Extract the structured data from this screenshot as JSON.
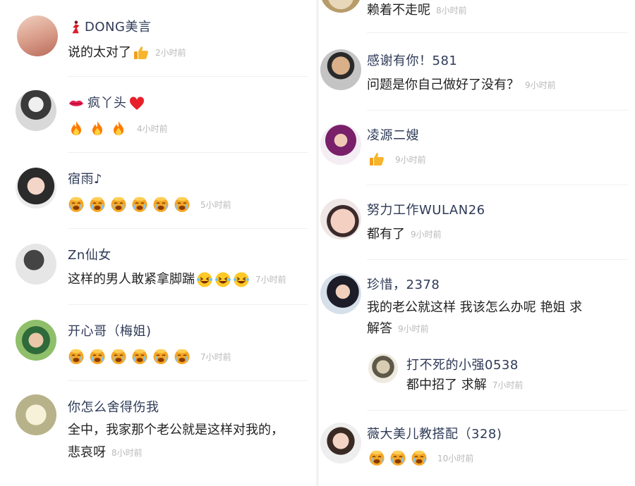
{
  "left": [
    {
      "name": "DONG美言",
      "text": "说的太对了",
      "time": "2小时前"
    },
    {
      "name": "疯丫头",
      "text": "",
      "time": "4小时前"
    },
    {
      "name": "宿雨♪",
      "text": "",
      "time": "5小时前"
    },
    {
      "name": "Zn仙女",
      "text": "这样的男人敢紧拿脚踹",
      "time": "7小时前"
    },
    {
      "name": "开心哥（梅姐)",
      "text": "",
      "time": "7小时前"
    },
    {
      "name": "你怎么舍得伤我",
      "text1": "全中，我家那个老公就是这样对我的，",
      "text2": "悲哀呀",
      "time": "8小时前"
    }
  ],
  "right": [
    {
      "name": "",
      "text": "赖着不走呢",
      "time": "8小时前"
    },
    {
      "name": "感谢有你！581",
      "text": "问题是你自己做好了没有？",
      "time": "9小时前"
    },
    {
      "name": "凌源二嫂",
      "text": "",
      "time": "9小时前"
    },
    {
      "name": "努力工作WULAN26",
      "text": "都有了",
      "time": "9小时前"
    },
    {
      "name": "珍惜，2378",
      "text1": "我的老公就这样  我该怎么办呢  艳姐  求",
      "text2": "解答",
      "time": "9小时前"
    },
    {
      "name": "打不死的小强0538",
      "text": "都中招了  求解",
      "time": "7小时前"
    },
    {
      "name": "薇大美儿教搭配（328)",
      "text": "",
      "time": "10小时前"
    }
  ],
  "icons": {
    "thumbs_up": "thumbs-up-icon",
    "fire": "fire-icon",
    "heart": "red-heart-icon",
    "lips": "lips-icon",
    "dancer": "dancer-icon",
    "laugh": "laughing-face-icon",
    "sob": "sobbing-face-icon"
  },
  "colors": {
    "name": "#2e3a57",
    "time": "#b9b9b9",
    "text": "#222222",
    "emoji_orange": "#f29a1e"
  }
}
